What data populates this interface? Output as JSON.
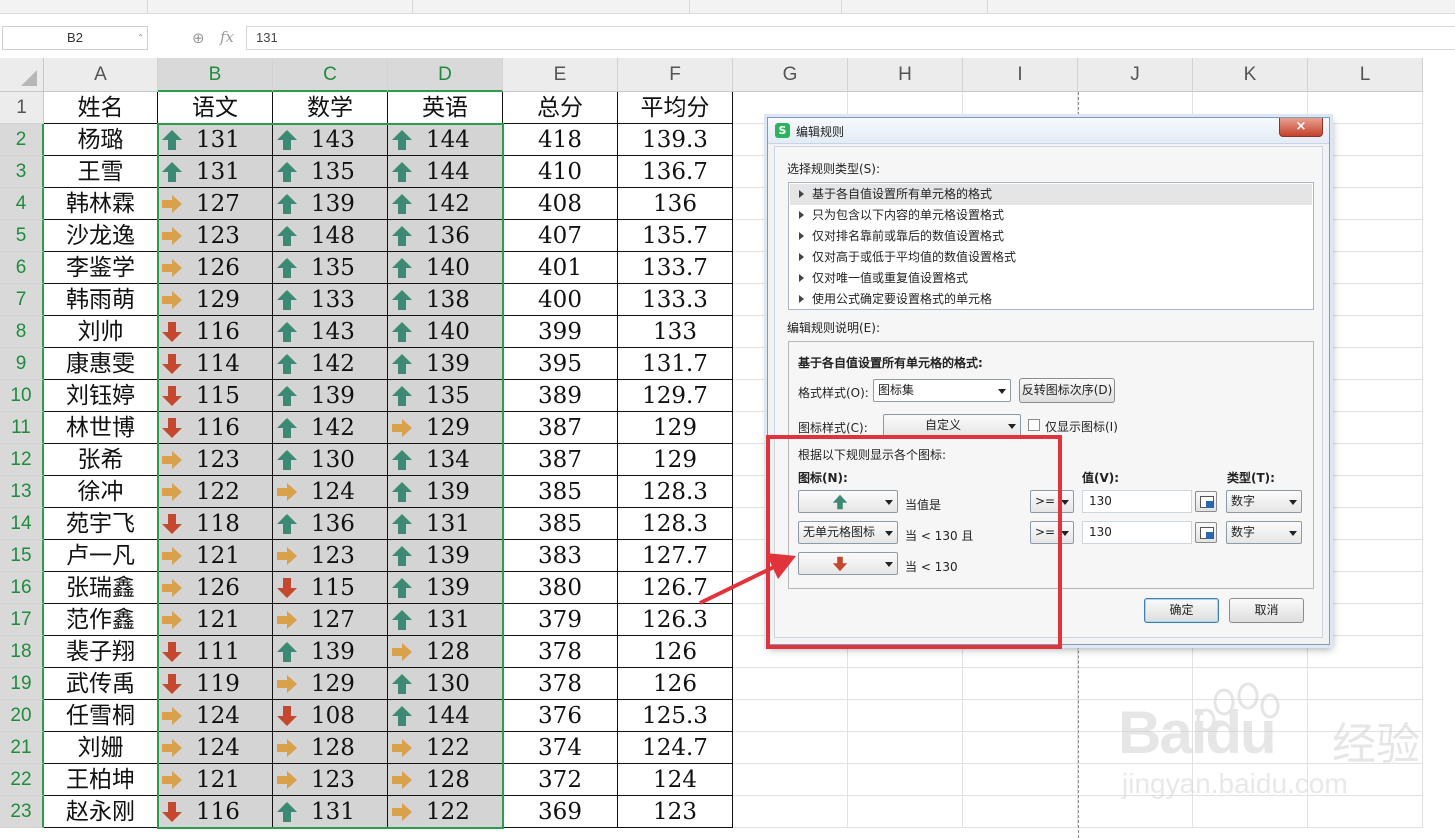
{
  "formula_bar": {
    "name_box": "B2",
    "fx_label": "fx",
    "formula": "131"
  },
  "columns": [
    "A",
    "B",
    "C",
    "D",
    "E",
    "F",
    "G",
    "H",
    "I",
    "J",
    "K",
    "L"
  ],
  "header_row": {
    "row": "1",
    "cells": [
      "姓名",
      "语文",
      "数学",
      "英语",
      "总分",
      "平均分"
    ]
  },
  "rows": [
    {
      "row": "2",
      "name": "杨璐",
      "chinese": {
        "v": "131",
        "icon": "up"
      },
      "math": {
        "v": "143",
        "icon": "up"
      },
      "english": {
        "v": "144",
        "icon": "up"
      },
      "total": "418",
      "avg": "139.3"
    },
    {
      "row": "3",
      "name": "王雪",
      "chinese": {
        "v": "131",
        "icon": "up"
      },
      "math": {
        "v": "135",
        "icon": "up"
      },
      "english": {
        "v": "144",
        "icon": "up"
      },
      "total": "410",
      "avg": "136.7"
    },
    {
      "row": "4",
      "name": "韩林霖",
      "chinese": {
        "v": "127",
        "icon": "right"
      },
      "math": {
        "v": "139",
        "icon": "up"
      },
      "english": {
        "v": "142",
        "icon": "up"
      },
      "total": "408",
      "avg": "136"
    },
    {
      "row": "5",
      "name": "沙龙逸",
      "chinese": {
        "v": "123",
        "icon": "right"
      },
      "math": {
        "v": "148",
        "icon": "up"
      },
      "english": {
        "v": "136",
        "icon": "up"
      },
      "total": "407",
      "avg": "135.7"
    },
    {
      "row": "6",
      "name": "李鉴学",
      "chinese": {
        "v": "126",
        "icon": "right"
      },
      "math": {
        "v": "135",
        "icon": "up"
      },
      "english": {
        "v": "140",
        "icon": "up"
      },
      "total": "401",
      "avg": "133.7"
    },
    {
      "row": "7",
      "name": "韩雨萌",
      "chinese": {
        "v": "129",
        "icon": "right"
      },
      "math": {
        "v": "133",
        "icon": "up"
      },
      "english": {
        "v": "138",
        "icon": "up"
      },
      "total": "400",
      "avg": "133.3"
    },
    {
      "row": "8",
      "name": "刘帅",
      "chinese": {
        "v": "116",
        "icon": "down"
      },
      "math": {
        "v": "143",
        "icon": "up"
      },
      "english": {
        "v": "140",
        "icon": "up"
      },
      "total": "399",
      "avg": "133"
    },
    {
      "row": "9",
      "name": "康惠雯",
      "chinese": {
        "v": "114",
        "icon": "down"
      },
      "math": {
        "v": "142",
        "icon": "up"
      },
      "english": {
        "v": "139",
        "icon": "up"
      },
      "total": "395",
      "avg": "131.7"
    },
    {
      "row": "10",
      "name": "刘钰婷",
      "chinese": {
        "v": "115",
        "icon": "down"
      },
      "math": {
        "v": "139",
        "icon": "up"
      },
      "english": {
        "v": "135",
        "icon": "up"
      },
      "total": "389",
      "avg": "129.7"
    },
    {
      "row": "11",
      "name": "林世博",
      "chinese": {
        "v": "116",
        "icon": "down"
      },
      "math": {
        "v": "142",
        "icon": "up"
      },
      "english": {
        "v": "129",
        "icon": "right"
      },
      "total": "387",
      "avg": "129"
    },
    {
      "row": "12",
      "name": "张希",
      "chinese": {
        "v": "123",
        "icon": "right"
      },
      "math": {
        "v": "130",
        "icon": "up"
      },
      "english": {
        "v": "134",
        "icon": "up"
      },
      "total": "387",
      "avg": "129"
    },
    {
      "row": "13",
      "name": "徐冲",
      "chinese": {
        "v": "122",
        "icon": "right"
      },
      "math": {
        "v": "124",
        "icon": "right"
      },
      "english": {
        "v": "139",
        "icon": "up"
      },
      "total": "385",
      "avg": "128.3"
    },
    {
      "row": "14",
      "name": "苑宇飞",
      "chinese": {
        "v": "118",
        "icon": "down"
      },
      "math": {
        "v": "136",
        "icon": "up"
      },
      "english": {
        "v": "131",
        "icon": "up"
      },
      "total": "385",
      "avg": "128.3"
    },
    {
      "row": "15",
      "name": "卢一凡",
      "chinese": {
        "v": "121",
        "icon": "right"
      },
      "math": {
        "v": "123",
        "icon": "right"
      },
      "english": {
        "v": "139",
        "icon": "up"
      },
      "total": "383",
      "avg": "127.7"
    },
    {
      "row": "16",
      "name": "张瑞鑫",
      "chinese": {
        "v": "126",
        "icon": "right"
      },
      "math": {
        "v": "115",
        "icon": "down"
      },
      "english": {
        "v": "139",
        "icon": "up"
      },
      "total": "380",
      "avg": "126.7"
    },
    {
      "row": "17",
      "name": "范作鑫",
      "chinese": {
        "v": "121",
        "icon": "right"
      },
      "math": {
        "v": "127",
        "icon": "right"
      },
      "english": {
        "v": "131",
        "icon": "up"
      },
      "total": "379",
      "avg": "126.3"
    },
    {
      "row": "18",
      "name": "裴子翔",
      "chinese": {
        "v": "111",
        "icon": "down"
      },
      "math": {
        "v": "139",
        "icon": "up"
      },
      "english": {
        "v": "128",
        "icon": "right"
      },
      "total": "378",
      "avg": "126"
    },
    {
      "row": "19",
      "name": "武传禹",
      "chinese": {
        "v": "119",
        "icon": "down"
      },
      "math": {
        "v": "129",
        "icon": "right"
      },
      "english": {
        "v": "130",
        "icon": "up"
      },
      "total": "378",
      "avg": "126"
    },
    {
      "row": "20",
      "name": "任雪桐",
      "chinese": {
        "v": "124",
        "icon": "right"
      },
      "math": {
        "v": "108",
        "icon": "down"
      },
      "english": {
        "v": "144",
        "icon": "up"
      },
      "total": "376",
      "avg": "125.3"
    },
    {
      "row": "21",
      "name": "刘姗",
      "chinese": {
        "v": "124",
        "icon": "right"
      },
      "math": {
        "v": "128",
        "icon": "right"
      },
      "english": {
        "v": "122",
        "icon": "right"
      },
      "total": "374",
      "avg": "124.7"
    },
    {
      "row": "22",
      "name": "王柏坤",
      "chinese": {
        "v": "121",
        "icon": "right"
      },
      "math": {
        "v": "123",
        "icon": "right"
      },
      "english": {
        "v": "128",
        "icon": "right"
      },
      "total": "372",
      "avg": "124"
    },
    {
      "row": "23",
      "name": "赵永刚",
      "chinese": {
        "v": "116",
        "icon": "down"
      },
      "math": {
        "v": "131",
        "icon": "up"
      },
      "english": {
        "v": "122",
        "icon": "right"
      },
      "total": "369",
      "avg": "123"
    }
  ],
  "icon_colors": {
    "up": "#3c8a73",
    "right": "#d9a24a",
    "down": "#c4482e"
  },
  "selection_color": "#2d9d4d",
  "dialog": {
    "title": "编辑规则",
    "close": "×",
    "select_rule_type_label": "选择规则类型(S):",
    "rule_types": [
      "基于各自值设置所有单元格的格式",
      "只为包含以下内容的单元格设置格式",
      "仅对排名靠前或靠后的数值设置格式",
      "仅对高于或低于平均值的数值设置格式",
      "仅对唯一值或重复值设置格式",
      "使用公式确定要设置格式的单元格"
    ],
    "edit_desc_label": "编辑规则说明(E):",
    "desc_heading": "基于各自值设置所有单元格的格式:",
    "format_style_label": "格式样式(O):",
    "format_style_value": "图标集",
    "reverse_button": "反转图标次序(D)",
    "icon_style_label": "图标样式(C):",
    "icon_style_value": "自定义",
    "show_icon_only_label": "仅显示图标(I)",
    "rules_heading": "根据以下规则显示各个图标:",
    "icon_col_label": "图标(N):",
    "value_col_label": "值(V):",
    "type_col_label": "类型(T):",
    "rule1_cond": "当值是",
    "rule1_op": ">=",
    "rule1_value": "130",
    "rule1_type": "数字",
    "rule2_icon": "无单元格图标",
    "rule2_cond": "当 < 130 且",
    "rule2_op": ">=",
    "rule2_value": "130",
    "rule2_type": "数字",
    "rule3_cond": "当 < 130",
    "ok_button": "确定",
    "cancel_button": "取消"
  },
  "annotation_color": "#e0333b",
  "watermark": {
    "logo": "Baidu",
    "product": "经验",
    "url": "jingyan.baidu.com"
  }
}
